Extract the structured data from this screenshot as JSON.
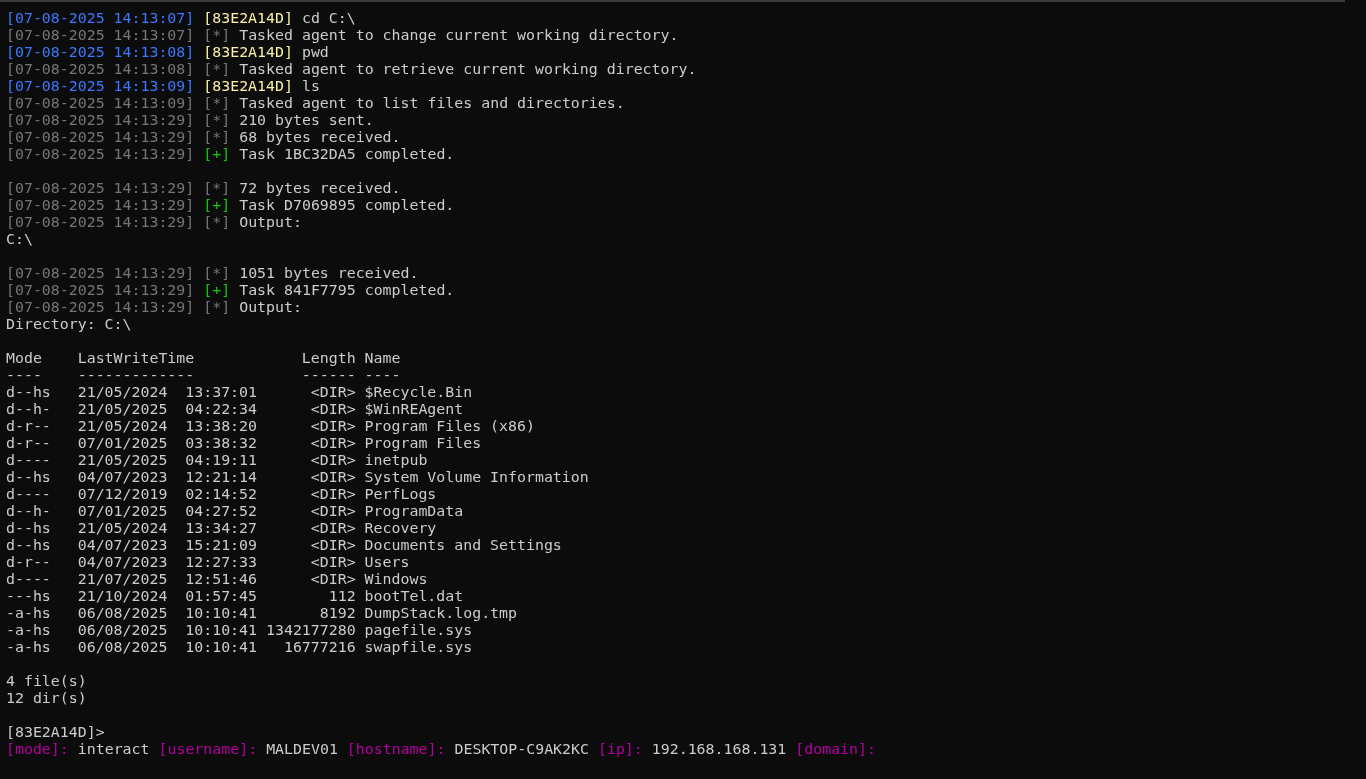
{
  "lines": [
    {
      "kind": "command",
      "timestamp": "[07-08-2025 14:13:07]",
      "agent": "[83E2A14D]",
      "text": "cd C:\\"
    },
    {
      "kind": "log",
      "timestamp": "[07-08-2025 14:13:07]",
      "tag": "[*]",
      "success": false,
      "text": "Tasked agent to change current working directory."
    },
    {
      "kind": "command",
      "timestamp": "[07-08-2025 14:13:08]",
      "agent": "[83E2A14D]",
      "text": "pwd"
    },
    {
      "kind": "log",
      "timestamp": "[07-08-2025 14:13:08]",
      "tag": "[*]",
      "success": false,
      "text": "Tasked agent to retrieve current working directory."
    },
    {
      "kind": "command",
      "timestamp": "[07-08-2025 14:13:09]",
      "agent": "[83E2A14D]",
      "text": "ls"
    },
    {
      "kind": "log",
      "timestamp": "[07-08-2025 14:13:09]",
      "tag": "[*]",
      "success": false,
      "text": "Tasked agent to list files and directories."
    },
    {
      "kind": "log",
      "timestamp": "[07-08-2025 14:13:29]",
      "tag": "[*]",
      "success": false,
      "text": "210 bytes sent."
    },
    {
      "kind": "log",
      "timestamp": "[07-08-2025 14:13:29]",
      "tag": "[*]",
      "success": false,
      "text": "68 bytes received."
    },
    {
      "kind": "log",
      "timestamp": "[07-08-2025 14:13:29]",
      "tag": "[+]",
      "success": true,
      "text": "Task 1BC32DA5 completed."
    },
    {
      "kind": "blank"
    },
    {
      "kind": "log",
      "timestamp": "[07-08-2025 14:13:29]",
      "tag": "[*]",
      "success": false,
      "text": "72 bytes received."
    },
    {
      "kind": "log",
      "timestamp": "[07-08-2025 14:13:29]",
      "tag": "[+]",
      "success": true,
      "text": "Task D7069895 completed."
    },
    {
      "kind": "log",
      "timestamp": "[07-08-2025 14:13:29]",
      "tag": "[*]",
      "success": false,
      "text": "Output:"
    },
    {
      "kind": "output",
      "text": "C:\\"
    },
    {
      "kind": "blank"
    },
    {
      "kind": "log",
      "timestamp": "[07-08-2025 14:13:29]",
      "tag": "[*]",
      "success": false,
      "text": "1051 bytes received."
    },
    {
      "kind": "log",
      "timestamp": "[07-08-2025 14:13:29]",
      "tag": "[+]",
      "success": true,
      "text": "Task 841F7795 completed."
    },
    {
      "kind": "log",
      "timestamp": "[07-08-2025 14:13:29]",
      "tag": "[*]",
      "success": false,
      "text": "Output:"
    },
    {
      "kind": "output",
      "text": "Directory: C:\\"
    },
    {
      "kind": "blank"
    },
    {
      "kind": "output",
      "text": "Mode    LastWriteTime            Length Name"
    },
    {
      "kind": "output",
      "text": "----    -------------            ------ ----"
    },
    {
      "kind": "output",
      "text": "d--hs   21/05/2024  13:37:01      <DIR> $Recycle.Bin"
    },
    {
      "kind": "output",
      "text": "d--h-   21/05/2025  04:22:34      <DIR> $WinREAgent"
    },
    {
      "kind": "output",
      "text": "d-r--   21/05/2024  13:38:20      <DIR> Program Files (x86)"
    },
    {
      "kind": "output",
      "text": "d-r--   07/01/2025  03:38:32      <DIR> Program Files"
    },
    {
      "kind": "output",
      "text": "d----   21/05/2025  04:19:11      <DIR> inetpub"
    },
    {
      "kind": "output",
      "text": "d--hs   04/07/2023  12:21:14      <DIR> System Volume Information"
    },
    {
      "kind": "output",
      "text": "d----   07/12/2019  02:14:52      <DIR> PerfLogs"
    },
    {
      "kind": "output",
      "text": "d--h-   07/01/2025  04:27:52      <DIR> ProgramData"
    },
    {
      "kind": "output",
      "text": "d--hs   21/05/2024  13:34:27      <DIR> Recovery"
    },
    {
      "kind": "output",
      "text": "d--hs   04/07/2023  15:21:09      <DIR> Documents and Settings"
    },
    {
      "kind": "output",
      "text": "d-r--   04/07/2023  12:27:33      <DIR> Users"
    },
    {
      "kind": "output",
      "text": "d----   21/07/2025  12:51:46      <DIR> Windows"
    },
    {
      "kind": "output",
      "text": "---hs   21/10/2024  01:57:45        112 bootTel.dat"
    },
    {
      "kind": "output",
      "text": "-a-hs   06/08/2025  10:10:41       8192 DumpStack.log.tmp"
    },
    {
      "kind": "output",
      "text": "-a-hs   06/08/2025  10:10:41 1342177280 pagefile.sys"
    },
    {
      "kind": "output",
      "text": "-a-hs   06/08/2025  10:10:41   16777216 swapfile.sys"
    },
    {
      "kind": "blank"
    },
    {
      "kind": "output",
      "text": "4 file(s)"
    },
    {
      "kind": "output",
      "text": "12 dir(s)"
    },
    {
      "kind": "blank"
    },
    {
      "kind": "prompt",
      "text": "[83E2A14D]>"
    }
  ],
  "status_bar": [
    {
      "label": "[mode]:",
      "value": "interact"
    },
    {
      "label": "[username]:",
      "value": "MALDEV01"
    },
    {
      "label": "[hostname]:",
      "value": "DESKTOP-C9AK2KC"
    },
    {
      "label": "[ip]:",
      "value": "192.168.168.131"
    },
    {
      "label": "[domain]:"
    }
  ]
}
